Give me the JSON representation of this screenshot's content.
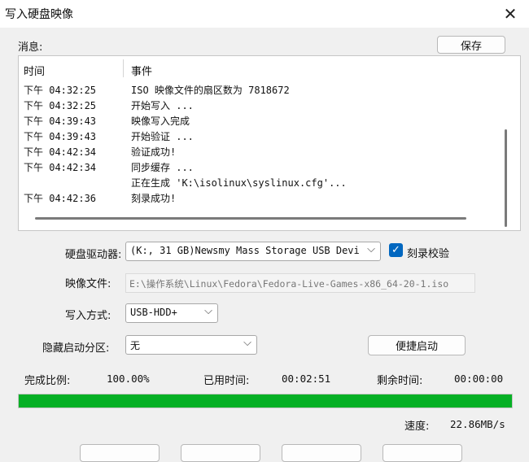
{
  "window": {
    "title": "写入硬盘映像",
    "close_glyph": "✕"
  },
  "messages": {
    "label": "消息:",
    "save_label": "保存",
    "columns": {
      "time": "时间",
      "event": "事件"
    },
    "rows": [
      {
        "time": "下午 04:32:25",
        "event": "ISO 映像文件的扇区数为 7818672"
      },
      {
        "time": "下午 04:32:25",
        "event": "开始写入 ..."
      },
      {
        "time": "下午 04:39:43",
        "event": "映像写入完成"
      },
      {
        "time": "下午 04:39:43",
        "event": "开始验证 ..."
      },
      {
        "time": "下午 04:42:34",
        "event": "验证成功!"
      },
      {
        "time": "下午 04:42:34",
        "event": "同步缓存 ..."
      },
      {
        "time": "",
        "event": "正在生成 'K:\\isolinux\\syslinux.cfg'..."
      },
      {
        "time": "下午 04:42:36",
        "event": "刻录成功!"
      }
    ]
  },
  "drive": {
    "label": "硬盘驱动器:",
    "value": "(K:, 31 GB)Newsmy Mass Storage USB Devi",
    "verify_label": "刻录校验",
    "verify_checked": true
  },
  "image_file": {
    "label": "映像文件:",
    "value": "E:\\操作系统\\Linux\\Fedora\\Fedora-Live-Games-x86_64-20-1.iso"
  },
  "write_mode": {
    "label": "写入方式:",
    "value": "USB-HDD+"
  },
  "hide_partition": {
    "label": "隐藏启动分区:",
    "value": "无"
  },
  "quick_boot_label": "便捷启动",
  "status": {
    "complete_label": "完成比例:",
    "complete_value": "100.00%",
    "elapsed_label": "已用时间:",
    "elapsed_value": "00:02:51",
    "remaining_label": "剩余时间:",
    "remaining_value": "00:00:00",
    "speed_label": "速度:",
    "speed_value": "22.86MB/s",
    "progress_fraction": 1.0
  },
  "colors": {
    "accent": "#0067c0",
    "progress": "#06b025"
  }
}
